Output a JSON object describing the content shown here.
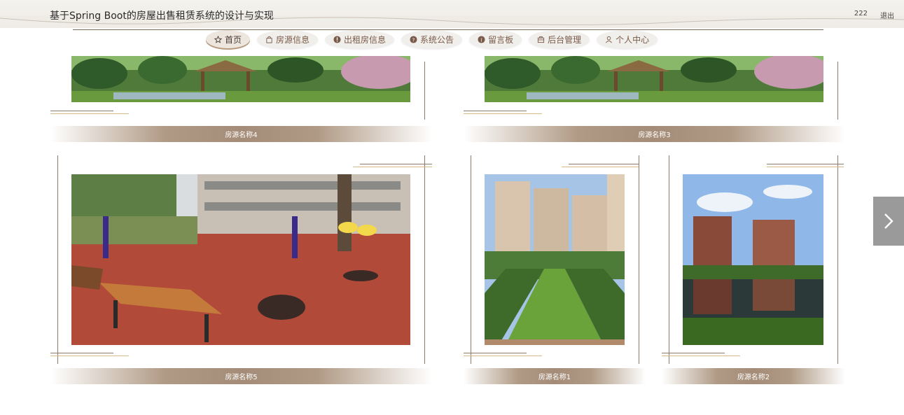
{
  "header": {
    "title": "基于Spring Boot的房屋出售租赁系统的设计与实现",
    "username": "222",
    "logout_label": "退出"
  },
  "nav": {
    "items": [
      {
        "label": "首页",
        "icon": "star-icon",
        "active": true
      },
      {
        "label": "房源信息",
        "icon": "bag-icon"
      },
      {
        "label": "出租房信息",
        "icon": "info-icon"
      },
      {
        "label": "系统公告",
        "icon": "question-icon"
      },
      {
        "label": "留言板",
        "icon": "info-icon"
      },
      {
        "label": "后台管理",
        "icon": "box-icon"
      },
      {
        "label": "个人中心",
        "icon": "person-icon"
      }
    ]
  },
  "cards": {
    "top_left": {
      "caption": "房源名称4",
      "image": "garden-pavilion"
    },
    "top_right": {
      "caption": "房源名称3",
      "image": "garden-pavilion"
    },
    "main_left": {
      "caption": "房源名称5",
      "image": "playground-benches"
    },
    "mid_right": {
      "caption": "房源名称1",
      "image": "apartment-lawn"
    },
    "far_right": {
      "caption": "房源名称2",
      "image": "apartment-lake"
    }
  },
  "carousel": {
    "next_icon": "chevron-right-icon"
  },
  "colors": {
    "accent": "#b09a85",
    "nav_text": "#7a5a48",
    "header_bg": "#f2efea"
  }
}
